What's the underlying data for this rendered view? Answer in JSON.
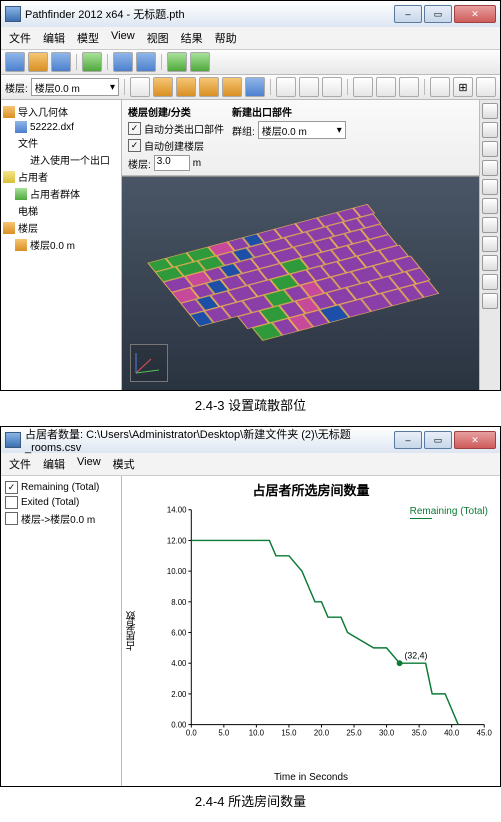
{
  "fig1": {
    "window_title": "Pathfinder 2012 x64 - 无标题.pth",
    "menu": [
      "文件",
      "编辑",
      "模型",
      "View",
      "视图",
      "结果",
      "帮助"
    ],
    "nav": {
      "combo_label": "楼层:",
      "combo_value": "楼层0.0 m",
      "tree": [
        {
          "label": "导入几何体",
          "icon": "i-org",
          "indent": 0
        },
        {
          "label": "52222.dxf",
          "icon": "i-blu",
          "indent": 1
        },
        {
          "label": "文件",
          "icon": "",
          "indent": 0
        },
        {
          "label": "进入使用一个出口",
          "icon": "",
          "indent": 1
        },
        {
          "label": "占用者",
          "icon": "i-ylw",
          "indent": 0
        },
        {
          "label": "占用者群体",
          "icon": "i-grn",
          "indent": 1
        },
        {
          "label": "电梯",
          "icon": "",
          "indent": 0
        },
        {
          "label": "楼层",
          "icon": "i-org",
          "indent": 0
        },
        {
          "label": "楼层0.0 m",
          "icon": "i-org",
          "indent": 1
        }
      ]
    },
    "panel": {
      "left_hdr": "楼层创建/分类",
      "cb1": "自动分类出口部件",
      "cb2": "自动创建楼层",
      "fl_label": "楼层:",
      "fl_value": "3.0",
      "fl_unit": "m",
      "right_hdr": "新建出口部件",
      "grp_label": "群组:",
      "grp_value": "楼层0.0 m"
    },
    "caption": "2.4-3 设置疏散部位"
  },
  "fig2": {
    "window_title": "占居者数量: C:\\Users\\Administrator\\Desktop\\新建文件夹 (2)\\无标题_rooms.csv",
    "menu": [
      "文件",
      "编辑",
      "View",
      "模式"
    ],
    "checks": [
      {
        "label": "Remaining (Total)",
        "checked": true
      },
      {
        "label": "Exited (Total)",
        "checked": false
      },
      {
        "label": "楼层->楼层0.0 m",
        "checked": false
      }
    ],
    "chart_data": {
      "type": "line",
      "title": "占居者所选房间数量",
      "xlabel": "Time in Seconds",
      "ylabel": "占居者数",
      "legend_pos": "top-right",
      "xlim": [
        0,
        45
      ],
      "ylim": [
        0,
        14
      ],
      "xticks": [
        0,
        5,
        10,
        15,
        20,
        25,
        30,
        35,
        40,
        45
      ],
      "yticks": [
        0,
        2,
        4,
        6,
        8,
        10,
        12,
        14
      ],
      "series": [
        {
          "name": "Remaining (Total)",
          "color": "#0a7a35",
          "x": [
            0,
            12,
            13,
            15,
            17,
            18,
            19,
            20,
            21,
            23,
            24,
            28,
            30,
            32,
            36,
            37,
            39,
            40,
            41
          ],
          "y": [
            12,
            12,
            11,
            11,
            10,
            9,
            8,
            8,
            7,
            7,
            6,
            5,
            5,
            4,
            4,
            2,
            2,
            1,
            0
          ]
        }
      ],
      "annotations": [
        {
          "x": 32,
          "y": 4,
          "text": "(32,4)"
        }
      ]
    },
    "caption": "2.4-4 所选房间数量"
  }
}
